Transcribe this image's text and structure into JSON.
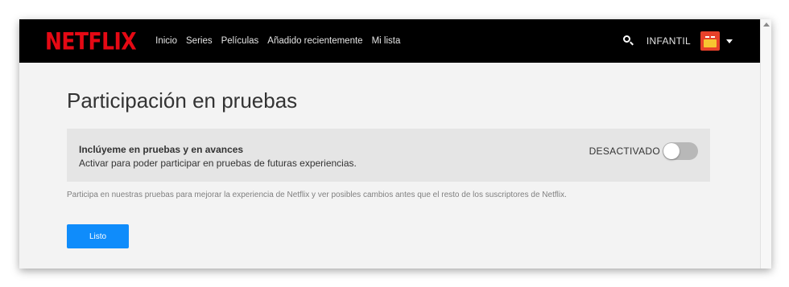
{
  "header": {
    "logo": "NETFLIX",
    "nav": [
      "Inicio",
      "Series",
      "Películas",
      "Añadido recientemente",
      "Mi lista"
    ],
    "profile_name": "INFANTIL"
  },
  "main": {
    "title": "Participación en pruebas",
    "setting": {
      "title": "Inclúyeme en pruebas y en avances",
      "description": "Activar para poder participar en pruebas de futuras experiencias.",
      "toggle_state": "DESACTIVADO"
    },
    "info": "Participa en nuestras pruebas para mejorar la experiencia de Netflix y ver posibles cambios antes que el resto de los suscriptores de Netflix.",
    "done_label": "Listo"
  },
  "colors": {
    "brand": "#e50914",
    "accent": "#0f8cfb",
    "toggle_off": "#b8b8b8"
  },
  "icons": [
    "search-icon",
    "chevron-down-icon",
    "profile-avatar"
  ]
}
